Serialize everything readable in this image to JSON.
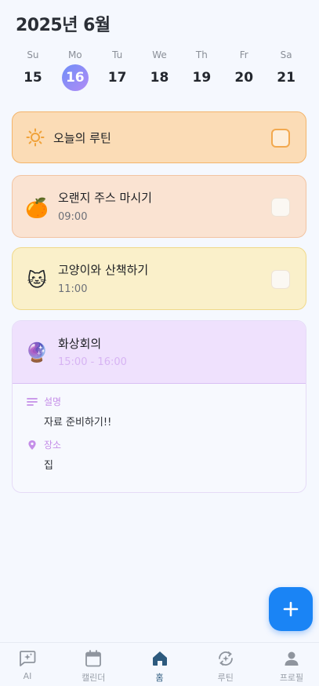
{
  "header": {
    "month_title": "2025년 6월"
  },
  "week": [
    {
      "dow": "Su",
      "date": "15",
      "selected": false
    },
    {
      "dow": "Mo",
      "date": "16",
      "selected": true
    },
    {
      "dow": "Tu",
      "date": "17",
      "selected": false
    },
    {
      "dow": "We",
      "date": "18",
      "selected": false
    },
    {
      "dow": "Th",
      "date": "19",
      "selected": false
    },
    {
      "dow": "Fr",
      "date": "20",
      "selected": false
    },
    {
      "dow": "Sa",
      "date": "21",
      "selected": false
    }
  ],
  "routine": {
    "icon": "sun-icon",
    "title": "오늘의 루틴",
    "checked": false
  },
  "tasks": [
    {
      "emoji": "🍊",
      "icon": "tangerine-icon",
      "title": "오랜지 주스 마시기",
      "time": "09:00",
      "checked": false,
      "color": "#fae3d2"
    },
    {
      "emoji": "🐱",
      "icon": "cat-icon",
      "title": "고양이와 산책하기",
      "time": "11:00",
      "checked": false,
      "color": "#faf0ca"
    }
  ],
  "meeting": {
    "emoji": "🔮",
    "icon": "crystal-ball-icon",
    "title": "화상회의",
    "time": "15:00 - 16:00",
    "description_label": "설명",
    "description": "자료 준비하기!!",
    "location_label": "장소",
    "location": "집",
    "color": "#efe1fd"
  },
  "fab": {
    "icon": "plus-icon"
  },
  "tabbar": [
    {
      "label": "AI",
      "icon": "ai-chat-icon",
      "active": false
    },
    {
      "label": "캘린더",
      "icon": "calendar-icon",
      "active": false
    },
    {
      "label": "홈",
      "icon": "home-icon",
      "active": true
    },
    {
      "label": "루틴",
      "icon": "routine-icon",
      "active": false
    },
    {
      "label": "프로필",
      "icon": "profile-icon",
      "active": false
    }
  ],
  "colors": {
    "accent": "#1a84f5",
    "selected_day_gradient": [
      "#6f8ef8",
      "#b28cf5"
    ],
    "routine_bg": "#fbdcb6",
    "active_tab": "#2d5a7e"
  }
}
